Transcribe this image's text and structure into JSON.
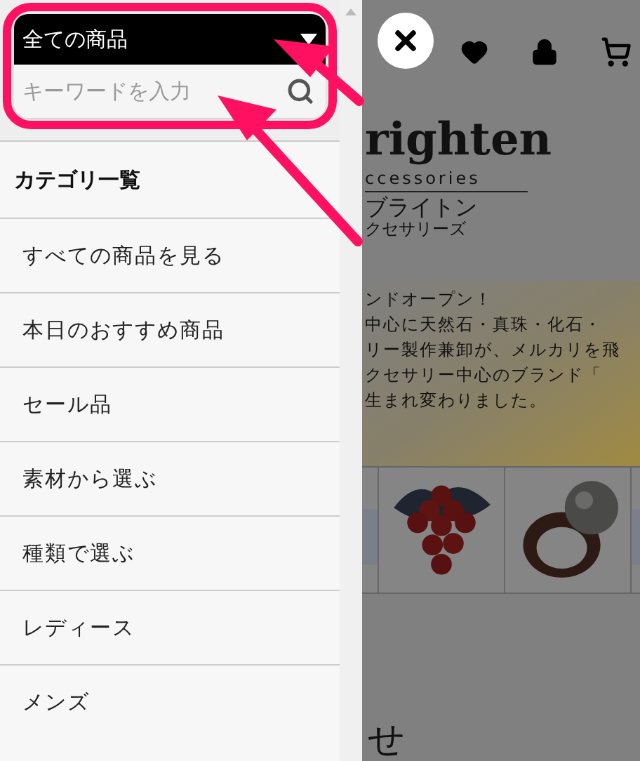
{
  "search": {
    "category": "全ての商品",
    "placeholder": "キーワードを入力"
  },
  "menu": {
    "heading": "カテゴリ一覧",
    "items": [
      {
        "label": "すべての商品を見る"
      },
      {
        "label": "本日のおすすめ商品"
      },
      {
        "label": "セール品"
      },
      {
        "label": "素材から選ぶ"
      },
      {
        "label": "種類で選ぶ"
      },
      {
        "label": "レディース"
      },
      {
        "label": "メンズ"
      }
    ]
  },
  "page": {
    "logo": {
      "title": "righten",
      "subtitle": "ccessories",
      "kana": "ブライトン",
      "kana_sub": "クセサリーズ"
    },
    "intro": [
      "ンドオープン！",
      "中心に天然石・真珠・化石・",
      "リー製作兼卸が、メルカリを飛",
      "クセサリー中心のブランド「",
      "生まれ変わりました。"
    ],
    "section_heading": "せ"
  }
}
